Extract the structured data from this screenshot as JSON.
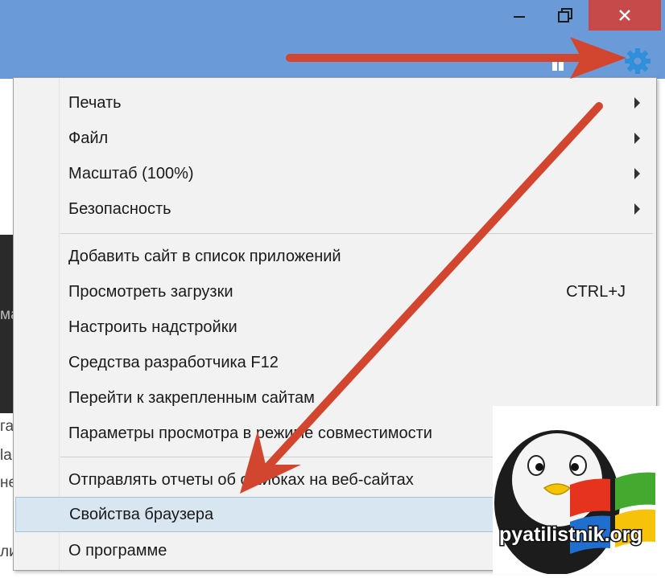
{
  "window": {
    "controls": {
      "minimize_icon": "minimize-icon",
      "restore_icon": "restore-icon",
      "close_icon": "close-icon"
    },
    "toolbar": {
      "favorites_icon": "favorites-icon",
      "tools_icon": "gear-icon"
    },
    "colors": {
      "titlebar": "#6b9ad9",
      "close": "#c74a4a",
      "gear": "#2f8fd8",
      "annotation_arrow": "#d2452f",
      "selection": "#d8e6f2"
    }
  },
  "background_page": {
    "fragments": [
      "ма",
      "га",
      "la",
      "не",
      "ли"
    ]
  },
  "menu": {
    "items": [
      {
        "label": "Печать",
        "submenu": true
      },
      {
        "label": "Файл",
        "submenu": true
      },
      {
        "label": "Масштаб (100%)",
        "submenu": true
      },
      {
        "label": "Безопасность",
        "submenu": true
      },
      {
        "label": "Добавить сайт в список приложений"
      },
      {
        "label": "Просмотреть загрузки",
        "shortcut": "CTRL+J"
      },
      {
        "label": "Настроить надстройки"
      },
      {
        "label": "Средства разработчика F12"
      },
      {
        "label": "Перейти к закрепленным сайтам"
      },
      {
        "label": "Параметры просмотра в режиме совместимости"
      },
      {
        "label": "Отправлять отчеты об ошибках на веб-сайтах"
      },
      {
        "label": "Свойства браузера",
        "selected": true
      },
      {
        "label": "О программе"
      }
    ]
  },
  "watermark": {
    "text": "pyatilistnik.org"
  }
}
